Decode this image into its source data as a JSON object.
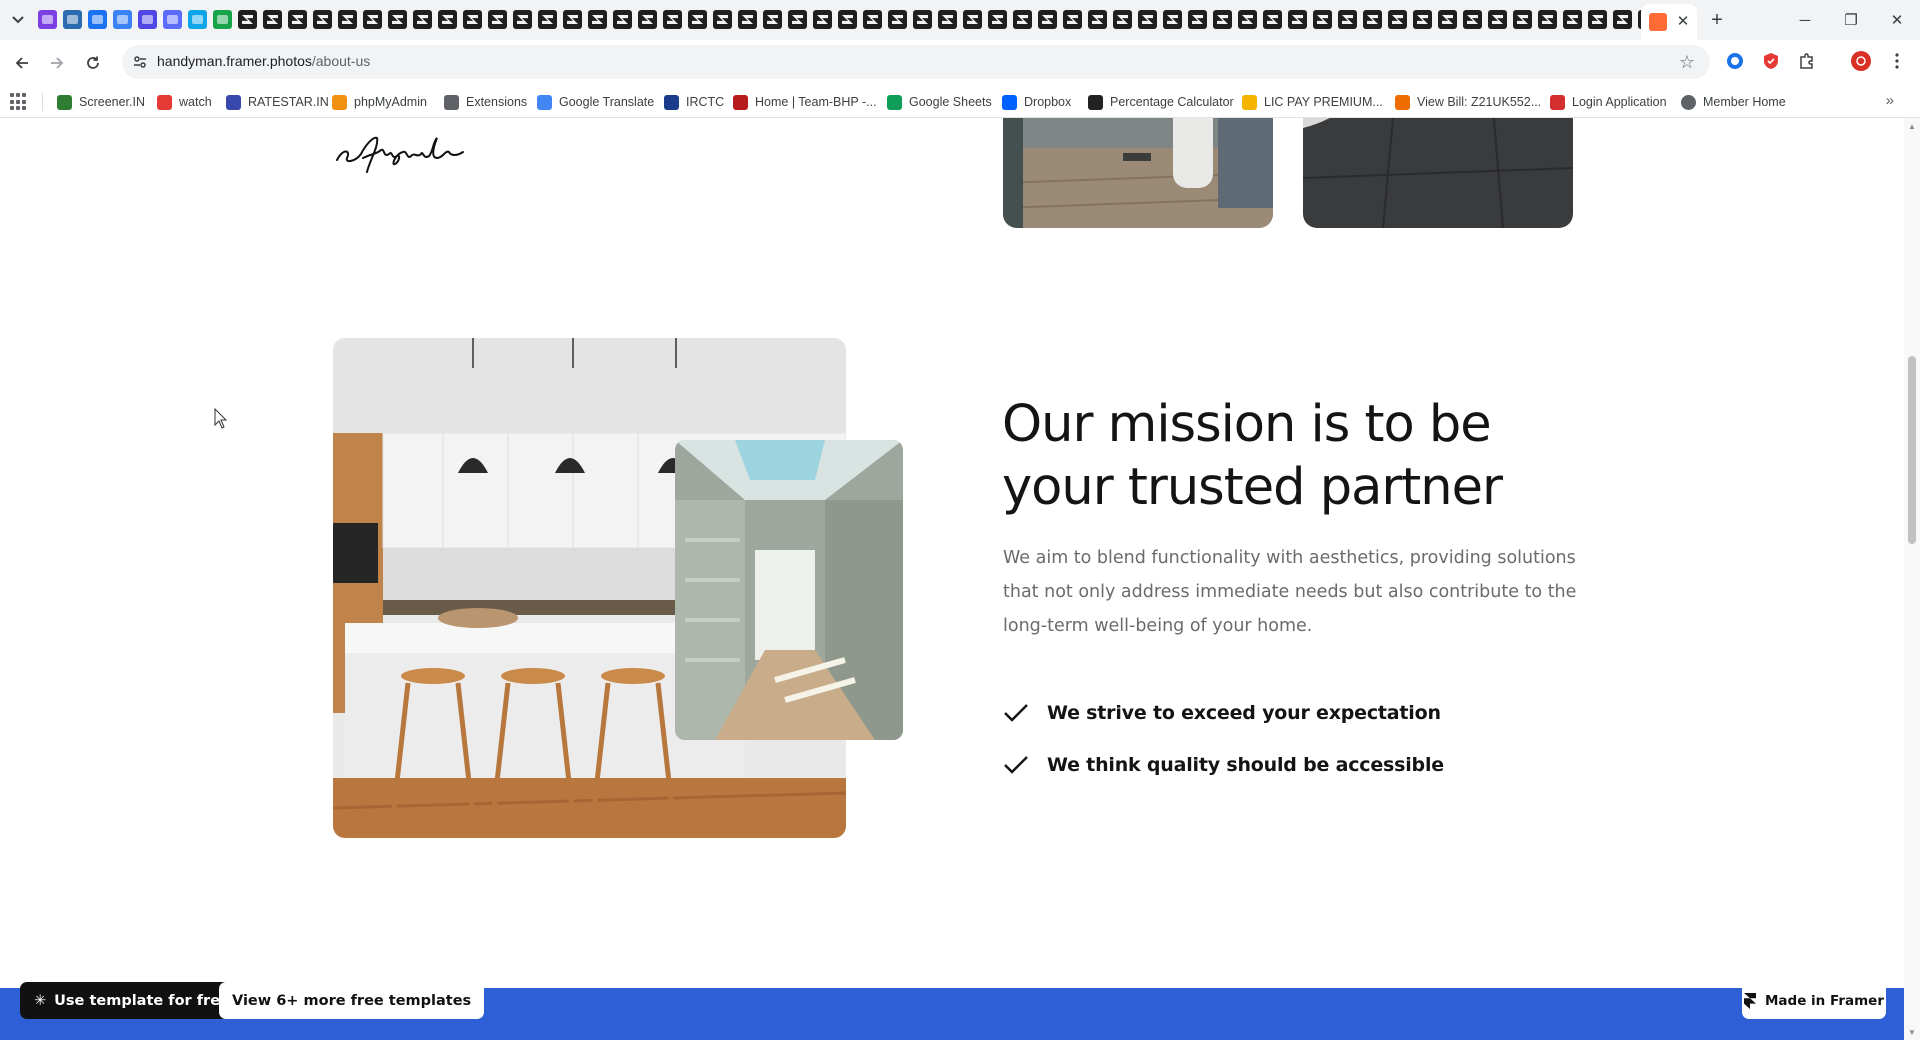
{
  "browser": {
    "url_host": "handyman.framer.photos",
    "url_path": "/about-us",
    "window_controls": {
      "minimize": "─",
      "maximize": "❐",
      "close": "✕"
    },
    "new_tab_glyph": "+",
    "tab_close_glyph": "✕"
  },
  "bookmarks": [
    {
      "label": "Screener.IN",
      "icon": "bar-chart-icon",
      "color": "#2e7d32"
    },
    {
      "label": "watch",
      "icon": "youtube-icon",
      "color": "#e53935"
    },
    {
      "label": "RATESTAR.IN",
      "icon": "ratestar-icon",
      "color": "#3949ab"
    },
    {
      "label": "phpMyAdmin",
      "icon": "phpmyadmin-icon",
      "color": "#f29111"
    },
    {
      "label": "Extensions",
      "icon": "puzzle-icon",
      "color": "#5f6368"
    },
    {
      "label": "Google Translate",
      "icon": "translate-icon",
      "color": "#4285f4"
    },
    {
      "label": "IRCTC",
      "icon": "irctc-icon",
      "color": "#1a3c8b"
    },
    {
      "label": "Home | Team-BHP -...",
      "icon": "teambhp-icon",
      "color": "#b71c1c"
    },
    {
      "label": "Google Sheets",
      "icon": "sheets-icon",
      "color": "#0f9d58"
    },
    {
      "label": "Dropbox",
      "icon": "dropbox-icon",
      "color": "#0061fe"
    },
    {
      "label": "Percentage Calculator",
      "icon": "calculator-icon",
      "color": "#222222"
    },
    {
      "label": "LIC PAY PREMIUM...",
      "icon": "lic-icon",
      "color": "#f4b400"
    },
    {
      "label": "View Bill: Z21UK552...",
      "icon": "bill-icon",
      "color": "#ef6c00"
    },
    {
      "label": "Login Application",
      "icon": "login-icon",
      "color": "#d32f2f"
    },
    {
      "label": "Member Home",
      "icon": "globe-icon",
      "color": "#5f6368"
    }
  ],
  "mission": {
    "title": "Our mission is to be your trusted partner",
    "body": "We aim to blend functionality with aesthetics, providing solutions that not only address immediate needs but also contribute to the long-term well-being of your home.",
    "points": [
      "We strive to exceed your expectation",
      "We think quality should be accessible"
    ]
  },
  "footer": {
    "use_template": "Use template for free",
    "more_templates": "View 6+ more free templates",
    "made_in": "Made in Framer"
  },
  "colors": {
    "accent_blue": "#2f5fd4",
    "title_text": "#141414",
    "body_text": "#6b6b6b"
  }
}
